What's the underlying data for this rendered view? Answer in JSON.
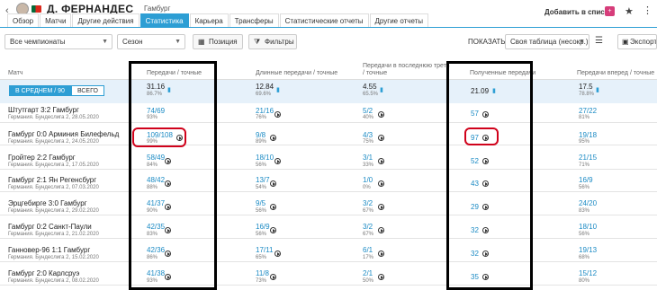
{
  "header": {
    "back": "‹",
    "player_name": "Д. ФЕРНАНДЕС",
    "team": "Гамбург",
    "add_to_list": "Добавить в список",
    "add_icon": "list-plus-icon",
    "star_icon": "star-icon",
    "more_icon": "more-vertical-icon"
  },
  "tabs": [
    "Обзор",
    "Матчи",
    "Другие действия",
    "Статистика",
    "Карьера",
    "Трансферы",
    "Статистические отчеты",
    "Другие отчеты"
  ],
  "active_tab": "Статистика",
  "toolbar": {
    "championship": "Все чемпионаты",
    "season": "Сезон",
    "position_btn": "Позиция",
    "filters_btn": "Фильтры",
    "show_label": "ПОКАЗАТЬ:",
    "table_select": "Своя таблица (несокр.)",
    "export_btn": "Экспорт"
  },
  "columns": {
    "match": "Матч",
    "passes": "Передачи / точные",
    "long_passes": "Длинные передачи / точные",
    "final_third_1": "Передачи в последнюю треть",
    "final_third_2": "/ точные",
    "received": "Полученные передачи",
    "forward": "Передачи вперед / точные"
  },
  "average": {
    "toggle_on": "В СРЕДНЕМ / 90",
    "toggle_off": "ВСЕГО",
    "passes": "31.16",
    "passes_pct": "86.7%",
    "long": "12.84",
    "long_pct": "69.6%",
    "final": "4.55",
    "final_pct": "65.5%",
    "received": "21.09",
    "forward": "17.5",
    "forward_pct": "78.8%"
  },
  "rows": [
    {
      "match": "Штутгарт 3:2 Гамбург",
      "info": "Германия. Бундеслига 2, 28.05.2020",
      "passes": "74/69",
      "passes_pct": "93%",
      "long": "21/16",
      "long_pct": "76%",
      "final": "5/2",
      "final_pct": "40%",
      "received": "57",
      "forward": "27/22",
      "forward_pct": "81%"
    },
    {
      "match": "Гамбург 0:0 Арминия Билефельд",
      "info": "Германия. Бундеслига 2, 24.05.2020",
      "passes": "109/108",
      "passes_pct": "99%",
      "long": "9/8",
      "long_pct": "89%",
      "final": "4/3",
      "final_pct": "75%",
      "received": "97",
      "forward": "19/18",
      "forward_pct": "95%"
    },
    {
      "match": "Гройтер 2:2 Гамбург",
      "info": "Германия. Бундеслига 2, 17.05.2020",
      "passes": "58/49",
      "passes_pct": "84%",
      "long": "18/10",
      "long_pct": "56%",
      "final": "3/1",
      "final_pct": "33%",
      "received": "52",
      "forward": "21/15",
      "forward_pct": "71%"
    },
    {
      "match": "Гамбург 2:1 Ян Регенсбург",
      "info": "Германия. Бундеслига 2, 07.03.2020",
      "passes": "48/42",
      "passes_pct": "88%",
      "long": "13/7",
      "long_pct": "54%",
      "final": "1/0",
      "final_pct": "0%",
      "received": "43",
      "forward": "16/9",
      "forward_pct": "56%"
    },
    {
      "match": "Эрцгебирге 3:0 Гамбург",
      "info": "Германия. Бундеслига 2, 29.02.2020",
      "passes": "41/37",
      "passes_pct": "90%",
      "long": "9/5",
      "long_pct": "56%",
      "final": "3/2",
      "final_pct": "67%",
      "received": "29",
      "forward": "24/20",
      "forward_pct": "83%"
    },
    {
      "match": "Гамбург 0:2 Санкт-Паули",
      "info": "Германия. Бундеслига 2, 21.02.2020",
      "passes": "42/35",
      "passes_pct": "83%",
      "long": "16/9",
      "long_pct": "56%",
      "final": "3/2",
      "final_pct": "67%",
      "received": "32",
      "forward": "18/10",
      "forward_pct": "56%"
    },
    {
      "match": "Ганновер-96 1:1 Гамбург",
      "info": "Германия. Бундеслига 2, 15.02.2020",
      "passes": "42/36",
      "passes_pct": "86%",
      "long": "17/11",
      "long_pct": "65%",
      "final": "6/1",
      "final_pct": "17%",
      "received": "32",
      "forward": "19/13",
      "forward_pct": "68%"
    },
    {
      "match": "Гамбург 2:0 Карлсруэ",
      "info": "Германия. Бундеслига 2, 08.02.2020",
      "passes": "41/38",
      "passes_pct": "93%",
      "long": "11/8",
      "long_pct": "73%",
      "final": "2/1",
      "final_pct": "50%",
      "received": "35",
      "forward": "15/12",
      "forward_pct": "80%"
    }
  ]
}
